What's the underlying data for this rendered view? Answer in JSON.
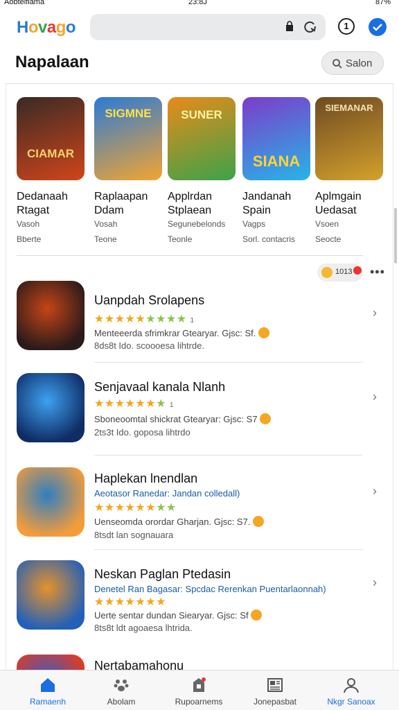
{
  "status_bar": {
    "carrier": "Aobtelfiama",
    "time": "23:8J",
    "battery": "87%"
  },
  "header": {
    "logo_text": "Hovago",
    "notifications_count": "1"
  },
  "title_row": {
    "title": "Napalaan",
    "search_button_label": "Salon"
  },
  "featured": [
    {
      "art_text": "CIAMAR",
      "name": "Dedanaah Rtagat",
      "sub1": "Vasoh",
      "sub2": "Bberte",
      "colors": [
        "#3a2a25",
        "#d0451b"
      ]
    },
    {
      "art_text": "SIGMNE",
      "name": "Raplaapan Ddam",
      "sub1": "Vosah",
      "sub2": "Teone",
      "colors": [
        "#2b7ad6",
        "#f2a531"
      ]
    },
    {
      "art_text": "SUNER",
      "name": "Applrdan Stplaean",
      "sub1": "Segunebelonds",
      "sub2": "Teonle",
      "colors": [
        "#e98a1a",
        "#3ba34a"
      ]
    },
    {
      "art_text": "SIANA",
      "name": "Jandanah Spain",
      "sub1": "Vagps",
      "sub2": "Sorl. contacris",
      "colors": [
        "#7d3cc9",
        "#26b5e8"
      ]
    },
    {
      "art_text": "SIEMANAR",
      "name": "Aplmgain Uedasat",
      "sub1": "Vsoen",
      "sub2": "Seocte",
      "colors": [
        "#6e4a23",
        "#d4a12c"
      ]
    }
  ],
  "chip": {
    "label": "1013"
  },
  "list": [
    {
      "title": "Uanpdah Srolapens",
      "promo": "",
      "rating_count": "1",
      "meta": "Menteeerda sfrimkrar Gtearyar.  Gjsc: Sf.",
      "downloads": "8ds8t Ido. scoooesa lihtrde.",
      "stars_gold": 5,
      "stars_green": 4,
      "colors": [
        "#2a1a1a",
        "#c54516"
      ]
    },
    {
      "title": "Senjavaal kanala Nlanh",
      "promo": "",
      "rating_count": "1",
      "meta": "Sboneoomtal shickrat Gtearyar:  Gjsc: S7",
      "downloads": "2ts3t Ido. goposa lihtrdo",
      "stars_gold": 6,
      "stars_green": 1,
      "colors": [
        "#0f2c66",
        "#3da2f0"
      ]
    },
    {
      "title": "Haplekan lnendlan",
      "promo": "Aeotasor Ranedar:  Jandan colledall)",
      "rating_count": "",
      "meta": "Uenseomda orordar Gharjan.  Gjsc: S7.",
      "downloads": "8tsdt lan sognauara",
      "stars_gold": 6,
      "stars_green": 2,
      "colors": [
        "#f59c3a",
        "#2f7fc1"
      ]
    },
    {
      "title": "Neskan Paglan Ptedasin",
      "promo": "Denetel Ran Bagasar:  Spcdac Rerenkan Puentarlaonnah)",
      "rating_count": "",
      "meta": "Uerte sentar dundan Siearyar.  Gjsc: Sf",
      "downloads": "8ts8t ldt agoaesa lhtrida.",
      "stars_gold": 7,
      "stars_green": 0,
      "colors": [
        "#2360b8",
        "#e6922a"
      ]
    },
    {
      "title": "Nertabamahonu",
      "promo": "",
      "rating_count": "",
      "meta": "",
      "downloads": "",
      "stars_gold": 0,
      "stars_green": 0,
      "colors": [
        "#e63a1c",
        "#2f5fd0"
      ]
    }
  ],
  "bottom_nav": [
    {
      "label": "Ramaenh",
      "icon": "home-icon",
      "active": true
    },
    {
      "label": "Abolam",
      "icon": "paw-icon",
      "active": false
    },
    {
      "label": "Rupoarnems",
      "icon": "badge-icon",
      "active": false
    },
    {
      "label": "Jonepasbat",
      "icon": "newspaper-icon",
      "active": false
    },
    {
      "label": "Nkgr Sanoax",
      "icon": "person-icon",
      "active": true
    }
  ],
  "accent_color": "#1a6fe0"
}
